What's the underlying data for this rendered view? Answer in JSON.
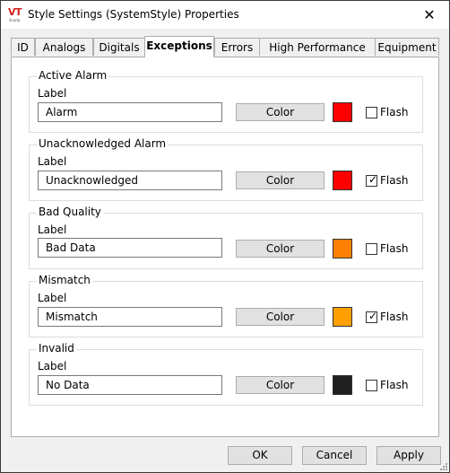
{
  "window": {
    "title": "Style Settings (SystemStyle) Properties",
    "logo_text": "VT",
    "logo_subtext": "Scada",
    "close_glyph": "✕"
  },
  "tabs": [
    {
      "label": "ID"
    },
    {
      "label": "Analogs"
    },
    {
      "label": "Digitals"
    },
    {
      "label": "Exceptions",
      "active": true
    },
    {
      "label": "Errors"
    },
    {
      "label": "High Performance"
    },
    {
      "label": "Equipment"
    }
  ],
  "groups": [
    {
      "title": "Active Alarm",
      "label": "Label",
      "value": "Alarm",
      "color_button": "Color",
      "swatch": "#ff0000",
      "flash_label": "Flash",
      "flash_checked": false
    },
    {
      "title": "Unacknowledged Alarm",
      "label": "Label",
      "value": "Unacknowledged",
      "color_button": "Color",
      "swatch": "#ff0000",
      "flash_label": "Flash",
      "flash_checked": true
    },
    {
      "title": "Bad Quality",
      "label": "Label",
      "value": "Bad Data",
      "color_button": "Color",
      "swatch": "#ff8000",
      "flash_label": "Flash",
      "flash_checked": false
    },
    {
      "title": "Mismatch",
      "label": "Label",
      "value": "Mismatch",
      "color_button": "Color",
      "swatch": "#ffa000",
      "flash_label": "Flash",
      "flash_checked": true
    },
    {
      "title": "Invalid",
      "label": "Label",
      "value": "No Data",
      "color_button": "Color",
      "swatch": "#202020",
      "flash_label": "Flash",
      "flash_checked": false
    }
  ],
  "buttons": {
    "ok": "OK",
    "cancel": "Cancel",
    "apply": "Apply"
  },
  "check_glyph": "✓"
}
